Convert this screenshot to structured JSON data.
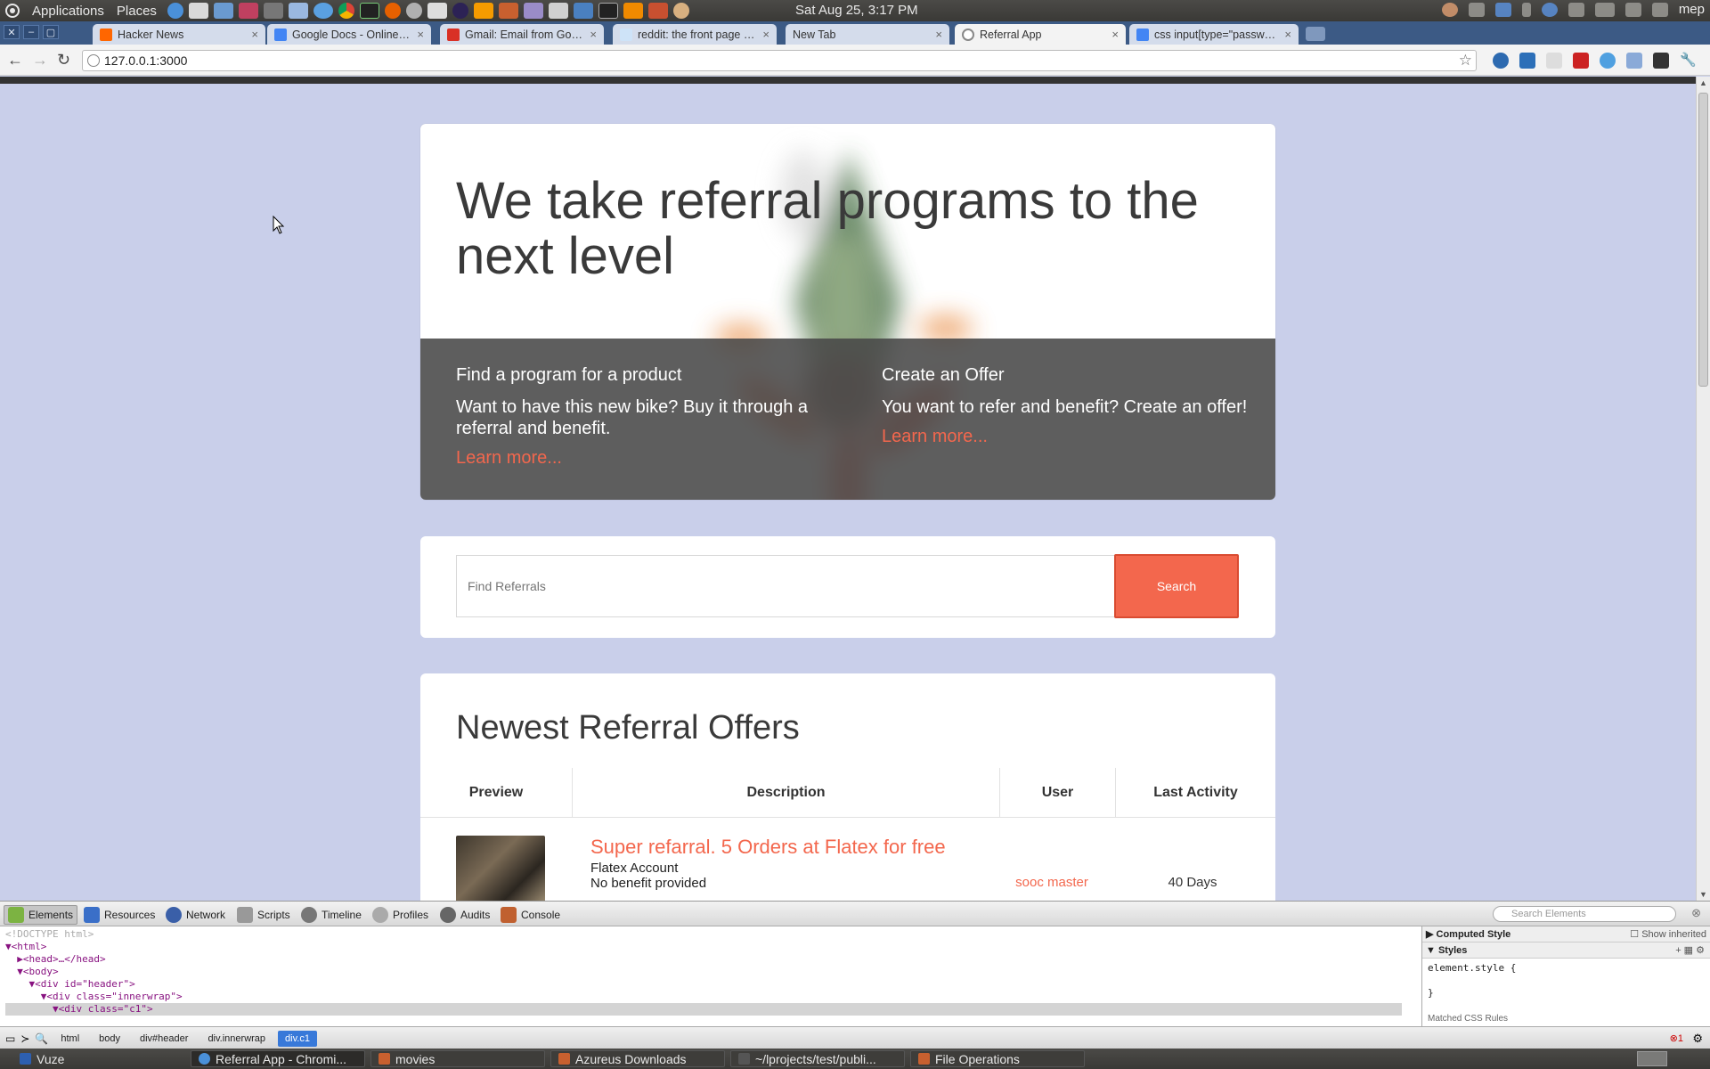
{
  "os": {
    "menu_applications": "Applications",
    "menu_places": "Places",
    "clock": "Sat Aug 25,  3:17 PM",
    "user": "mep",
    "taskbar": [
      {
        "label": "Vuze",
        "color": "#2d5fb0"
      },
      {
        "label": "Referral App - Chromi...",
        "color": "#4a90d9"
      },
      {
        "label": "movies",
        "color": "#c8602f"
      },
      {
        "label": "Azureus Downloads",
        "color": "#c8602f"
      },
      {
        "label": "~/lprojects/test/publi...",
        "color": "#555555"
      },
      {
        "label": "File Operations",
        "color": "#c8602f"
      }
    ]
  },
  "browser": {
    "tabs": [
      {
        "label": "Hacker News",
        "favicon_color": "#ff6600"
      },
      {
        "label": "Google Docs - Online docu",
        "favicon_color": "#4285f4"
      },
      {
        "label": "Gmail: Email from Google",
        "favicon_color": "#d93025"
      },
      {
        "label": "reddit: the front page of t",
        "favicon_color": "#cee3f8"
      },
      {
        "label": "New Tab",
        "favicon_color": "#d4dceb"
      },
      {
        "label": "Referral App",
        "favicon_color": "#8a8a8a"
      },
      {
        "label": "css input[type=\"password",
        "favicon_color": "#4285f4"
      }
    ],
    "tab_close": "×",
    "url": "127.0.0.1:3000",
    "back": "←",
    "forward": "→",
    "reload": "↻",
    "bookmark_star": "☆",
    "wrench": "🔧"
  },
  "page": {
    "hero_title": "We take referral programs to the next level",
    "promo_left": {
      "heading": "Find a program for a product",
      "text": "Want to have this new bike? Buy it through a referral and benefit.",
      "link": "Learn more..."
    },
    "promo_right": {
      "heading": "Create an Offer",
      "text": "You want to refer and benefit? Create an offer!",
      "link": "Learn more..."
    },
    "search": {
      "placeholder": "Find Referrals",
      "button": "Search"
    },
    "offers": {
      "heading": "Newest Referral Offers",
      "columns": [
        "Preview",
        "Description",
        "User",
        "Last Activity"
      ],
      "rows": [
        {
          "title": "Super refarral. 5 Orders at Flatex for free",
          "product": "Flatex Account",
          "benefit": "No benefit provided",
          "user": "sooc master",
          "activity": "40 Days"
        }
      ]
    },
    "accent_color": "#f3674d"
  },
  "devtools": {
    "tabs": [
      "Elements",
      "Resources",
      "Network",
      "Scripts",
      "Timeline",
      "Profiles",
      "Audits",
      "Console"
    ],
    "search_placeholder": "Search Elements",
    "dom_lines": [
      "<!DOCTYPE html>",
      "▼<html>",
      "  ▶<head>…</head>",
      "  ▼<body>",
      "    ▼<div id=\"header\">",
      "      ▼<div class=\"innerwrap\">",
      "        ▼<div class=\"c1\">"
    ],
    "computed_style": "Computed Style",
    "show_inherited": "Show inherited",
    "styles": "Styles",
    "element_style": "element.style {\n\n}",
    "matched_rules": "Matched CSS Rules",
    "breadcrumbs": [
      "html",
      "body",
      "div#header",
      "div.innerwrap",
      "div.c1"
    ],
    "error_count": "1"
  }
}
